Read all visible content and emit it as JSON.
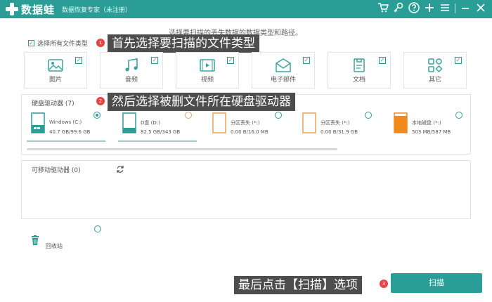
{
  "titlebar": {
    "app_name": "数据蛙",
    "subtitle": "数据恢复专家（未注册）",
    "icons": [
      "cart-icon",
      "key-icon",
      "help-icon",
      "plus-icon",
      "menu-icon",
      "minimize-icon",
      "close-icon"
    ]
  },
  "instruction": "选择要扫描的丢失数据的数据类型和路径。",
  "file_types": {
    "select_all_label": "选择所有文件类型",
    "items": [
      {
        "label": "图片",
        "icon": "image-icon",
        "checked": true
      },
      {
        "label": "音频",
        "icon": "audio-icon",
        "checked": true
      },
      {
        "label": "视频",
        "icon": "video-icon",
        "checked": true
      },
      {
        "label": "电子邮件",
        "icon": "email-icon",
        "checked": true
      },
      {
        "label": "文档",
        "icon": "document-icon",
        "checked": true
      },
      {
        "label": "其它",
        "icon": "other-icon",
        "checked": true
      }
    ]
  },
  "callouts": {
    "step1": "首先选择要扫描的文件类型",
    "step2": "然后选择被删文件所在硬盘驱动器",
    "step3": "最后点击【扫描】选项",
    "badge1": "1",
    "badge2": "2",
    "badge3": "3"
  },
  "hard_drives": {
    "title": "硬盘驱动器 (7)",
    "drives": [
      {
        "name": "Windows (C:)",
        "size": "40.7 GB/99.6 GB",
        "icon": "windows-drive-icon",
        "selected": true,
        "fill": 0.41
      },
      {
        "name": "D盘 (D:)",
        "size": "82.5 GB/343 GB",
        "icon": "drive-icon",
        "selected": false,
        "fill": 0.24
      },
      {
        "name": "分区丢失 (*:)",
        "size": "0.00  B/16.0 MB",
        "icon": "lost-partition-icon",
        "selected": false,
        "fill": 0
      },
      {
        "name": "分区丢失 (*:)",
        "size": "0.00  B/31.9 GB",
        "icon": "lost-partition-icon",
        "selected": false,
        "fill": 0
      },
      {
        "name": "本地磁盘 (*:)",
        "size": "503 MB/587 MB",
        "icon": "local-disk-icon",
        "selected": false,
        "fill": 0.86
      }
    ]
  },
  "removable": {
    "title": "可移动驱动器 (0)",
    "refresh_icon": "refresh-icon"
  },
  "recycle_bin": {
    "label": "回收站",
    "icon": "recycle-bin-icon"
  },
  "scan_button": "扫描",
  "colors": {
    "accent": "#2a9e96",
    "callout_bg": "#4d4d4d",
    "badge": "#e54545",
    "orange": "#f08a1c"
  }
}
